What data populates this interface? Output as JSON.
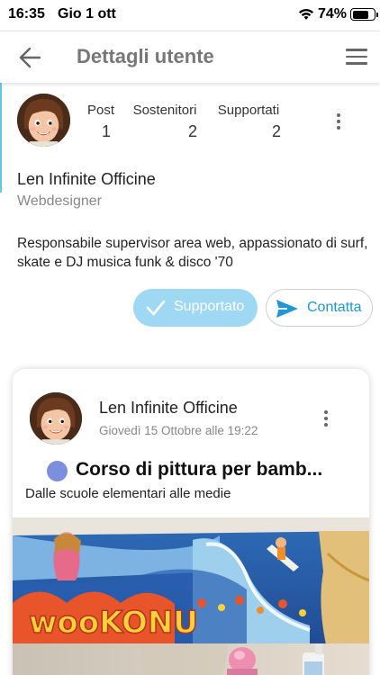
{
  "status_bar": {
    "time": "16:35",
    "date": "Gio 1 ott",
    "battery_percent": "74%",
    "battery_level": 0.74
  },
  "header": {
    "title": "Dettagli utente",
    "back_icon": "back-arrow-icon",
    "menu_icon": "hamburger-menu-icon"
  },
  "profile": {
    "stats": [
      {
        "label": "Post",
        "value": "1"
      },
      {
        "label": "Sostenitori",
        "value": "2"
      },
      {
        "label": "Supportati",
        "value": "2"
      }
    ],
    "name": "Len Infinite Officine",
    "role": "Webdesigner",
    "bio": "Responsabile supervisor area web, appassionato di surf, skate e DJ musica funk & disco '70",
    "supported_button": "Supportato",
    "contact_button": "Contatta"
  },
  "post": {
    "author": "Len Infinite Officine",
    "date": "Giovedì 15 Ottobre alle 19:22",
    "title": "Corso di pittura per bamb...",
    "subtitle": "Dalle scuole elementari alle medie",
    "title_dot_color": "#7c8fdc"
  },
  "colors": {
    "accent": "#62c7e4",
    "supported_bg": "#9fd8f2",
    "contact_text": "#2196d4"
  }
}
